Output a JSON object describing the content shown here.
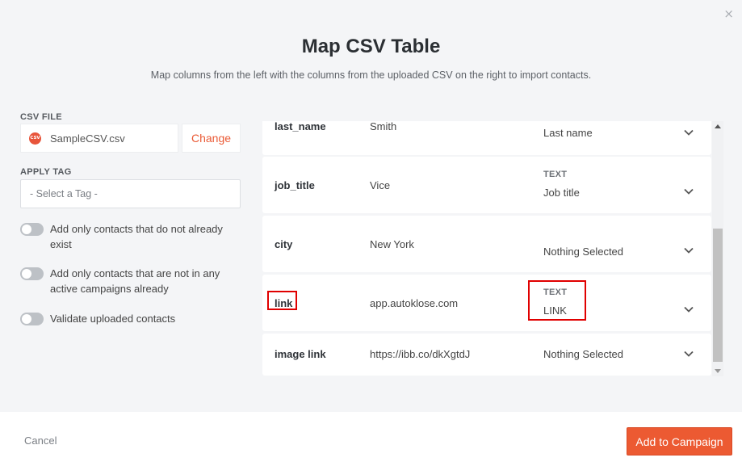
{
  "modal": {
    "close_icon": "×",
    "title": "Map CSV Table",
    "subtitle": "Map columns from the left with the columns from the uploaded CSV on the right to import contacts."
  },
  "left": {
    "csv_file_label": "CSV FILE",
    "csv_icon_text": "CSV",
    "file_name": "SampleCSV.csv",
    "change_label": "Change",
    "apply_tag_label": "APPLY TAG",
    "tag_placeholder": "- Select a Tag -",
    "toggles": [
      {
        "label": "Add only contacts that do not already exist",
        "on": false
      },
      {
        "label": "Add only contacts that are not in any active campaigns already",
        "on": false
      },
      {
        "label": "Validate uploaded contacts",
        "on": false
      }
    ]
  },
  "rows": [
    {
      "column": "last_name",
      "value": "Smith",
      "type": "",
      "field": "Last name"
    },
    {
      "column": "job_title",
      "value": "Vice",
      "type": "TEXT",
      "field": "Job title"
    },
    {
      "column": "city",
      "value": "New York",
      "type": "",
      "field": "Nothing Selected"
    },
    {
      "column": "link",
      "value": "app.autoklose.com",
      "type": "TEXT",
      "field": "LINK"
    },
    {
      "column": "image link",
      "value": "https://ibb.co/dkXgtdJ",
      "type": "",
      "field": "Nothing Selected"
    }
  ],
  "footer": {
    "cancel_label": "Cancel",
    "submit_label": "Add to Campaign"
  },
  "colors": {
    "accent": "#ec5a32",
    "highlight": "#e00000"
  }
}
